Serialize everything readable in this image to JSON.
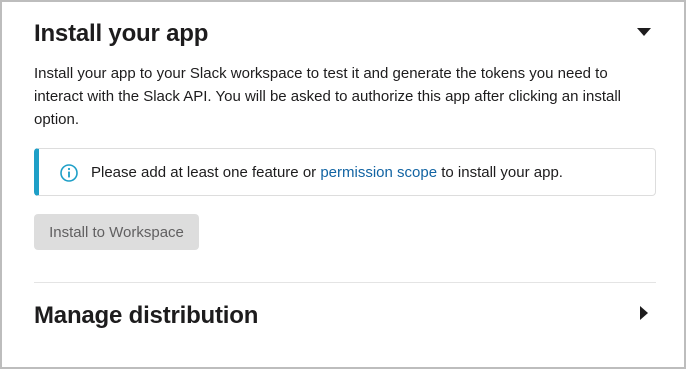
{
  "install_section": {
    "title": "Install your app",
    "toggle_icon": "caret-down-icon",
    "description": "Install your app to your Slack workspace to test it and generate the tokens you need to interact with the Slack API. You will be asked to authorize this app after clicking an install option.",
    "notice": {
      "icon": "info-icon",
      "text_before": "Please add at least one feature or ",
      "link_text": "permission scope",
      "text_after": " to install your app."
    },
    "install_button_label": "Install to Workspace"
  },
  "distribution_section": {
    "title": "Manage distribution",
    "toggle_icon": "caret-right-icon"
  },
  "colors": {
    "accent_border": "#1e9fc7",
    "link": "#1264a3",
    "disabled_button_bg": "#dddddd",
    "text": "#1d1c1d"
  }
}
